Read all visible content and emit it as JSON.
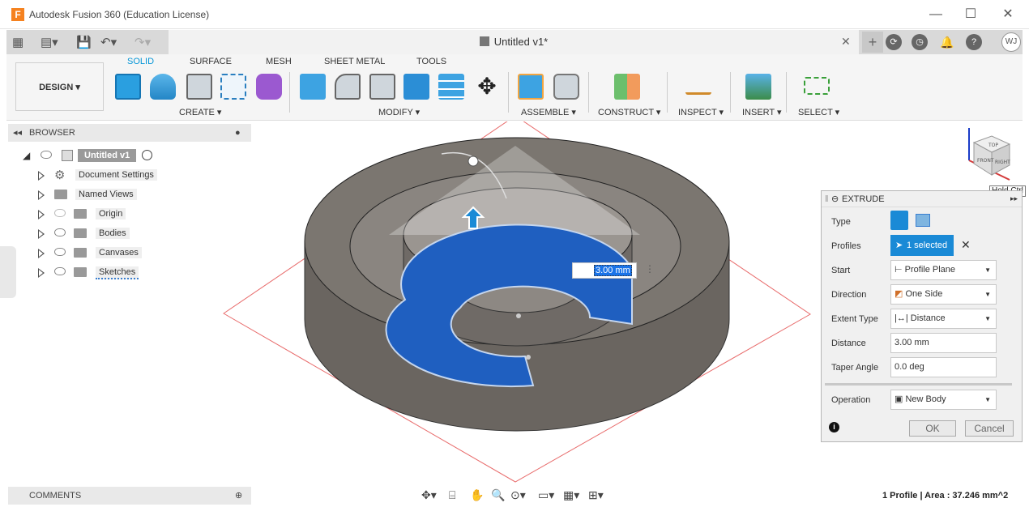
{
  "app": {
    "window_title": "Autodesk Fusion 360 (Education License)",
    "logo_letter": "F",
    "doc_tab_title": "Untitled v1*",
    "user_initials": "WJ"
  },
  "window_buttons": {
    "minimize": "—",
    "maximize": "☐",
    "close": "✕"
  },
  "ribbon": {
    "workspace": "DESIGN",
    "tabs": [
      "SOLID",
      "SURFACE",
      "MESH",
      "SHEET METAL",
      "TOOLS"
    ],
    "groups": [
      "CREATE",
      "MODIFY",
      "ASSEMBLE",
      "CONSTRUCT",
      "INSPECT",
      "INSERT",
      "SELECT"
    ]
  },
  "browser": {
    "title": "BROWSER",
    "root": "Untitled v1",
    "items": [
      "Document Settings",
      "Named Views",
      "Origin",
      "Bodies",
      "Canvases",
      "Sketches"
    ]
  },
  "comments": {
    "title": "COMMENTS"
  },
  "viewport": {
    "dimension_value": "3.00 mm",
    "viewcube_tooltip": "Hold Ctrl",
    "viewcube_faces": [
      "TOP",
      "FRONT",
      "RIGHT"
    ]
  },
  "extrude_panel": {
    "title": "EXTRUDE",
    "fields": {
      "type_label": "Type",
      "profiles_label": "Profiles",
      "profiles_value": "1 selected",
      "start_label": "Start",
      "start_value": "Profile Plane",
      "direction_label": "Direction",
      "direction_value": "One Side",
      "extent_label": "Extent Type",
      "extent_value": "Distance",
      "distance_label": "Distance",
      "distance_value": "3.00 mm",
      "taper_label": "Taper Angle",
      "taper_value": "0.0 deg",
      "operation_label": "Operation",
      "operation_value": "New Body"
    },
    "ok": "OK",
    "cancel": "Cancel"
  },
  "status_bar": {
    "profile_info": "1 Profile | Area : 37.246 mm^2"
  },
  "colors": {
    "accent": "#0696d7",
    "selection_blue": "#1a8ad6",
    "body_gray": "#6f6a64",
    "sketch_red": "#e86b6b"
  }
}
